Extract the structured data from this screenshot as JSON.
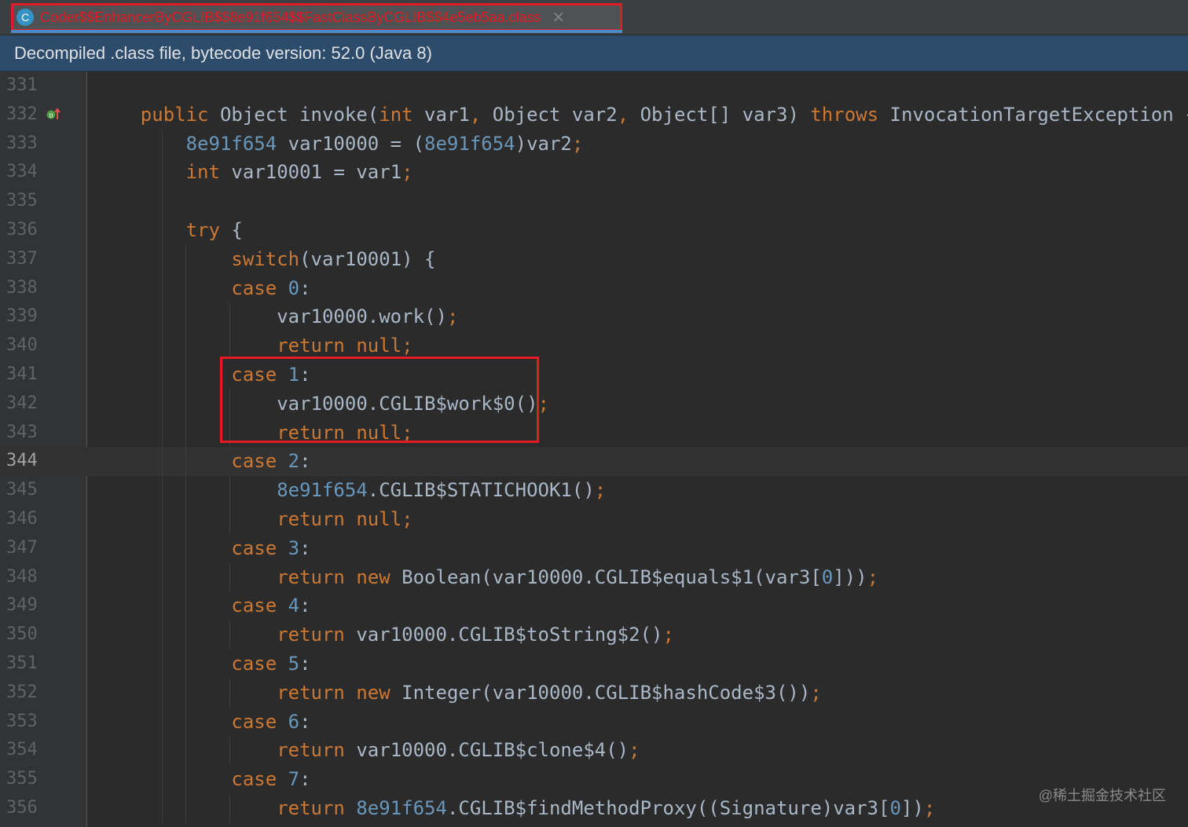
{
  "tab": {
    "icon_letter": "C",
    "title": "Coder$$EnhancerByCGLIB$$8e91f654$$FastClassByCGLIB$$4e5eb5aa.class",
    "close_glyph": "✕"
  },
  "infobar": {
    "text": "Decompiled .class file, bytecode version: 52.0 (Java 8)"
  },
  "current_line": "344",
  "lines": [
    {
      "n": "331",
      "code": ""
    },
    {
      "n": "332",
      "code": "    public Object invoke(int var1, Object var2, Object[] var3) throws InvocationTargetException {"
    },
    {
      "n": "333",
      "code": "        8e91f654 var10000 = (8e91f654)var2;"
    },
    {
      "n": "334",
      "code": "        int var10001 = var1;"
    },
    {
      "n": "335",
      "code": ""
    },
    {
      "n": "336",
      "code": "        try {"
    },
    {
      "n": "337",
      "code": "            switch(var10001) {"
    },
    {
      "n": "338",
      "code": "            case 0:"
    },
    {
      "n": "339",
      "code": "                var10000.work();"
    },
    {
      "n": "340",
      "code": "                return null;"
    },
    {
      "n": "341",
      "code": "            case 1:"
    },
    {
      "n": "342",
      "code": "                var10000.CGLIB$work$0();"
    },
    {
      "n": "343",
      "code": "                return null;"
    },
    {
      "n": "344",
      "code": "            case 2:"
    },
    {
      "n": "345",
      "code": "                8e91f654.CGLIB$STATICHOOK1();"
    },
    {
      "n": "346",
      "code": "                return null;"
    },
    {
      "n": "347",
      "code": "            case 3:"
    },
    {
      "n": "348",
      "code": "                return new Boolean(var10000.CGLIB$equals$1(var3[0]));"
    },
    {
      "n": "349",
      "code": "            case 4:"
    },
    {
      "n": "350",
      "code": "                return var10000.CGLIB$toString$2();"
    },
    {
      "n": "351",
      "code": "            case 5:"
    },
    {
      "n": "352",
      "code": "                return new Integer(var10000.CGLIB$hashCode$3());"
    },
    {
      "n": "353",
      "code": "            case 6:"
    },
    {
      "n": "354",
      "code": "                return var10000.CGLIB$clone$4();"
    },
    {
      "n": "355",
      "code": "            case 7:"
    },
    {
      "n": "356",
      "code": "                return 8e91f654.CGLIB$findMethodProxy((Signature)var3[0]);"
    }
  ],
  "watermark": "@稀土掘金技术社区",
  "colors": {
    "keyword": "#cc7832",
    "number": "#6897bb",
    "text": "#a9b7c6",
    "annotation_box": "#e31b23",
    "background": "#2b2b2b"
  },
  "icons": {
    "class_icon": "class-icon",
    "override_marker": "override-gutter-icon",
    "close": "close-icon"
  }
}
